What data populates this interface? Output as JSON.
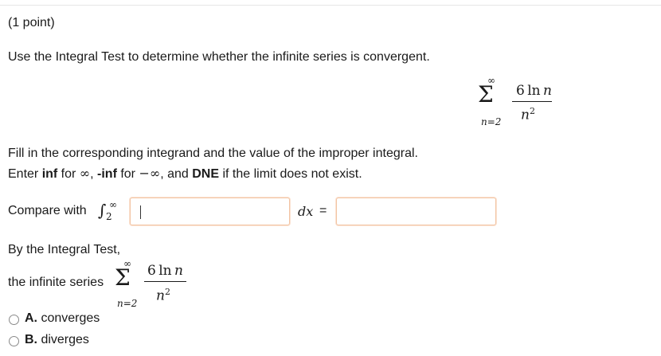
{
  "question": {
    "points": "(1 point)",
    "prompt": "Use the Integral Test to determine whether the infinite series is convergent."
  },
  "series": {
    "sum_top": "∞",
    "sum_symbol": "Σ",
    "sum_bottom": "n=2",
    "numerator_coef": "6",
    "numerator_fn": "ln",
    "numerator_var": "n",
    "denominator_base": "n",
    "denominator_exp": "2"
  },
  "instructions": {
    "line1": "Fill in the corresponding integrand and the value of the improper integral.",
    "inf_keyword": "inf",
    "for_text_1": " for ",
    "inf_symbol": "∞",
    "comma_1": ", ",
    "neg_inf_keyword": "-inf",
    "for_text_2": " for ",
    "neg_inf_symbol": "−∞",
    "and_text": ", and ",
    "dne_keyword": "DNE",
    "tail": " if the limit does not exist.",
    "enter_word": "Enter "
  },
  "compare": {
    "label": "Compare with",
    "int_symbol": "∫",
    "int_lower": "2",
    "int_upper": "∞",
    "dx": "dx",
    "equals": "=",
    "integrand_value": "",
    "integral_value": ""
  },
  "conclusion": {
    "by_test": "By the Integral Test,",
    "series_label": "the infinite series",
    "options": [
      {
        "letter": "A.",
        "label": "converges",
        "selected": false
      },
      {
        "letter": "B.",
        "label": "diverges",
        "selected": false
      }
    ]
  },
  "colors": {
    "input_border": "#f2c4a3",
    "text": "#1a1a1a"
  }
}
